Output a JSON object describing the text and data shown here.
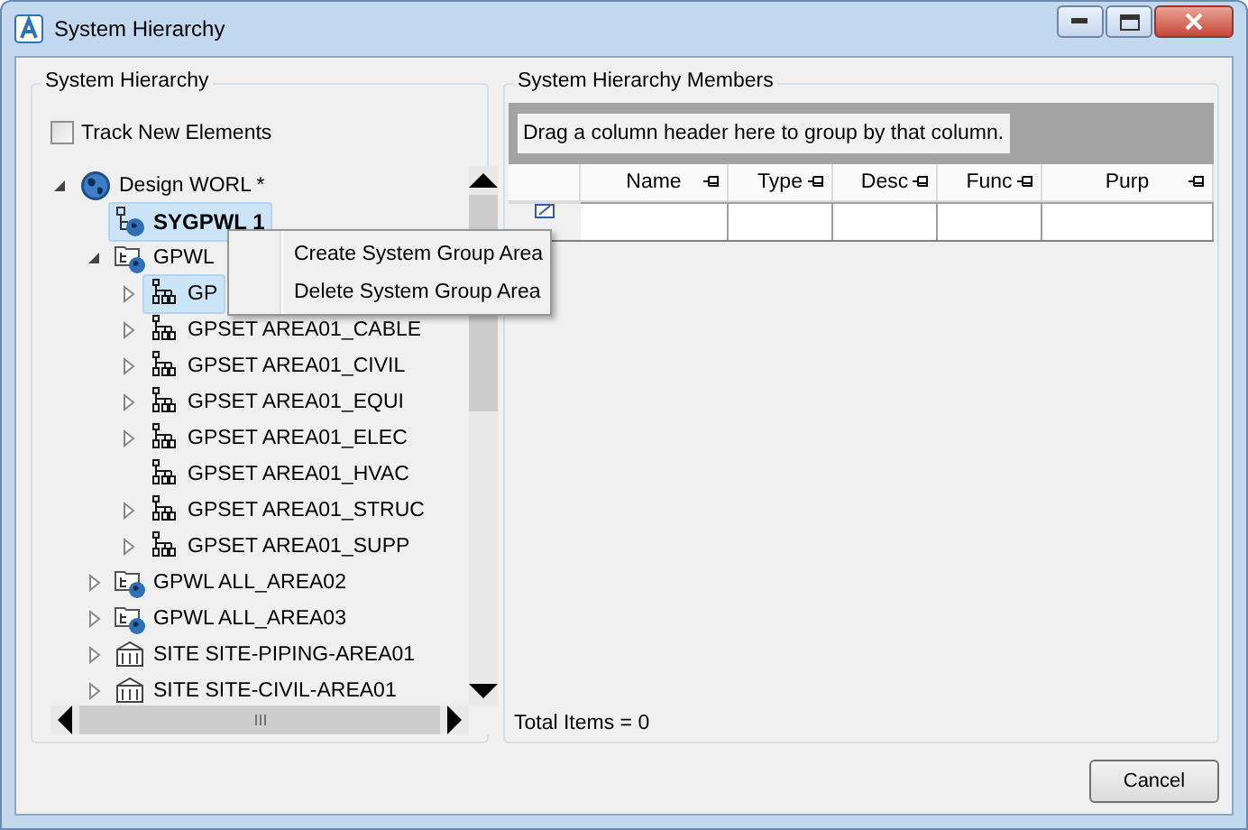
{
  "window": {
    "title": "System Hierarchy"
  },
  "hierarchy": {
    "title": "System Hierarchy",
    "track_new_elements": {
      "label": "Track New Elements",
      "checked": false
    },
    "tree": [
      {
        "label": "Design WORL *",
        "kind": "world",
        "expanded": true,
        "selected": false,
        "children": [
          {
            "label": "SYGPWL 1",
            "kind": "system",
            "selected": true
          },
          {
            "label": "GPWL",
            "kind": "group",
            "expanded": true,
            "selected": false,
            "children": [
              {
                "label": "GP",
                "kind": "set",
                "expanded": false,
                "selected": true
              },
              {
                "label": "GPSET AREA01_CABLE",
                "kind": "set",
                "expanded": false,
                "selected": false
              },
              {
                "label": "GPSET AREA01_CIVIL",
                "kind": "set",
                "expanded": false,
                "selected": false
              },
              {
                "label": "GPSET AREA01_EQUI",
                "kind": "set",
                "expanded": false,
                "selected": false
              },
              {
                "label": "GPSET AREA01_ELEC",
                "kind": "set",
                "expanded": false,
                "selected": false
              },
              {
                "label": "GPSET AREA01_HVAC",
                "kind": "set",
                "selected": false
              },
              {
                "label": "GPSET AREA01_STRUC",
                "kind": "set",
                "expanded": false,
                "selected": false
              },
              {
                "label": "GPSET AREA01_SUPP",
                "kind": "set",
                "expanded": false,
                "selected": false
              }
            ]
          },
          {
            "label": "GPWL ALL_AREA02",
            "kind": "group",
            "expanded": false,
            "selected": false
          },
          {
            "label": "GPWL ALL_AREA03",
            "kind": "group",
            "expanded": false,
            "selected": false
          },
          {
            "label": "SITE SITE-PIPING-AREA01",
            "kind": "site",
            "expanded": false,
            "selected": false
          },
          {
            "label": "SITE SITE-CIVIL-AREA01",
            "kind": "site",
            "expanded": false,
            "selected": false
          }
        ]
      }
    ]
  },
  "context_menu": {
    "items": [
      "Create System Group Area",
      "Delete System Group Area"
    ]
  },
  "members": {
    "title": "System Hierarchy Members",
    "group_by_hint": "Drag a column header here to group by that column.",
    "columns": [
      "Name",
      "Type",
      "Desc",
      "Func",
      "Purp"
    ],
    "total": "Total Items = 0"
  },
  "buttons": [
    "Cancel"
  ]
}
